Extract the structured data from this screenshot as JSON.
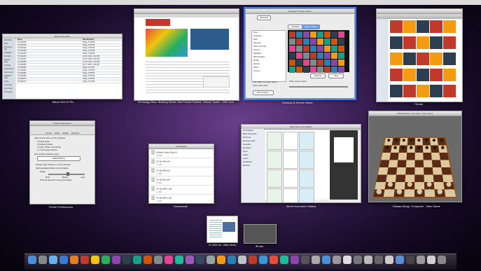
{
  "captions": {
    "finder": "Macs FAS 22 Pls",
    "cnet": "Technology News: Breaking Stories, New Product Reviews, Science, Space - CNET.com",
    "desktop": "Desktop & Screen Saver",
    "itunes": "iTunes",
    "prefs": "Finder Preferences",
    "downloads": "Downloads",
    "word": "Word Document Gallery",
    "chess": "Edward Burg / Computer - New Game",
    "x2": "X2 (Still Life, Utility Mode)",
    "iphoto": "iPhoto"
  },
  "desktop_window": {
    "show_all": "Show All",
    "tab_desktop": "Desktop",
    "tab_screensaver": "Screen Saver",
    "options": "Options",
    "test": "Test",
    "add_corners": "Hot Corners...",
    "use_random": "Use random screen saver",
    "show_clock": "Show with clock",
    "start_label": "Start screen saver:",
    "list": [
      "Flurry",
      "Arabesque",
      "Shell",
      "Spectrum",
      "Word of the Day",
      "Pictures",
      "MobileMe",
      "RSS Visualizer",
      "Shuffle",
      "Abstract",
      "Beach",
      "Cosmos"
    ]
  },
  "prefs_window": {
    "tabs": [
      "General",
      "Labels",
      "Sidebar",
      "Advanced"
    ],
    "show_items": "Show these items on the desktop:",
    "items": [
      "Hard disks",
      "External disks",
      "CDs, DVDs, and iPods",
      "Connected servers"
    ],
    "new_window_label": "New Finder windows open:",
    "new_window_value": "Edward Burg",
    "always_open": "Always open folders in a new window",
    "spring_loaded": "Spring-loaded folders and windows",
    "delay_label": "Delay:",
    "delay_short": "Short",
    "delay_medium": "Medium",
    "delay_long": "Long",
    "press_space": "Press the space bar to open immediately."
  },
  "downloads_window": {
    "title": "Downloads",
    "files": [
      "Edward_Burg_Estat.tif",
      "X2 Sp1045.aiff",
      "X2 Sp1030.aiff",
      "X2 Sp1022.aiff",
      "X2 Sp1008.1.aiff",
      "X2 Sp1006.1.aiff",
      "X2 Sp1003.1.aiff"
    ],
    "sizes": [
      "2.8 MB",
      "1.1 MB",
      "1.0 MB",
      "0.9 MB",
      "1.2 MB",
      "1.0 MB",
      "0.8 MB"
    ]
  },
  "finder_window": {
    "title": "Macs FAS 22 Pls",
    "sidebar": [
      "DEVICES",
      "iDisk",
      "Macintosh HD",
      "SHARED",
      "PLACES",
      "Edward Burg",
      "Desktop",
      "Applications",
      "Documents",
      "SEARCH FOR",
      "Today",
      "Yesterday",
      "Past Week",
      "All Images"
    ],
    "col_name": "Name",
    "col_date": "Date Modified",
    "files": [
      "X2 Sp1045",
      "X2 Sp1030",
      "X2 Sp1022",
      "X2 Sp1008",
      "X2 Sp1006",
      "X2 Sp1003",
      "X2 Sp1001",
      "X2 Sp0998",
      "X2 Sp0995",
      "X2 Sp0990",
      "X2 Sp0987",
      "X2 Sp0984",
      "X2 Sp0980",
      "X2 Sp0977",
      "X2 Sp0972"
    ],
    "dates": [
      "Today, 5:04 PM",
      "Today, 4:59 PM",
      "Today, 4:55 PM",
      "Today, 4:51 PM",
      "Today, 4:48 PM",
      "Jul 20, 2012, 2:11 PM",
      "Jul 19, 2012, 6:30 PM",
      "Jul 18, 2012, 3:02 PM",
      "Apr 6, 2012, 5:15 PM",
      "Today, 4:12 PM",
      "Today, 4:05 PM",
      "Today, 3:59 PM",
      "Today, 3:55 PM",
      "Today, 3:40 PM",
      "Today, 3:31 PM"
    ]
  },
  "word_window": {
    "title": "Word Document Gallery",
    "cats": [
      "All Templates",
      "Blank Documents",
      "Brochures",
      "Business Cards",
      "Calendars",
      "Envelopes",
      "Flyers",
      "Labels",
      "Letters",
      "Newsletters",
      "Resumes"
    ]
  },
  "chess_window": {
    "title": "Edward Burg / Computer - New Game"
  },
  "colors": {
    "selection": "#3c7ff7",
    "chess_light": "#e0c89a",
    "chess_dark": "#5a2a15"
  }
}
